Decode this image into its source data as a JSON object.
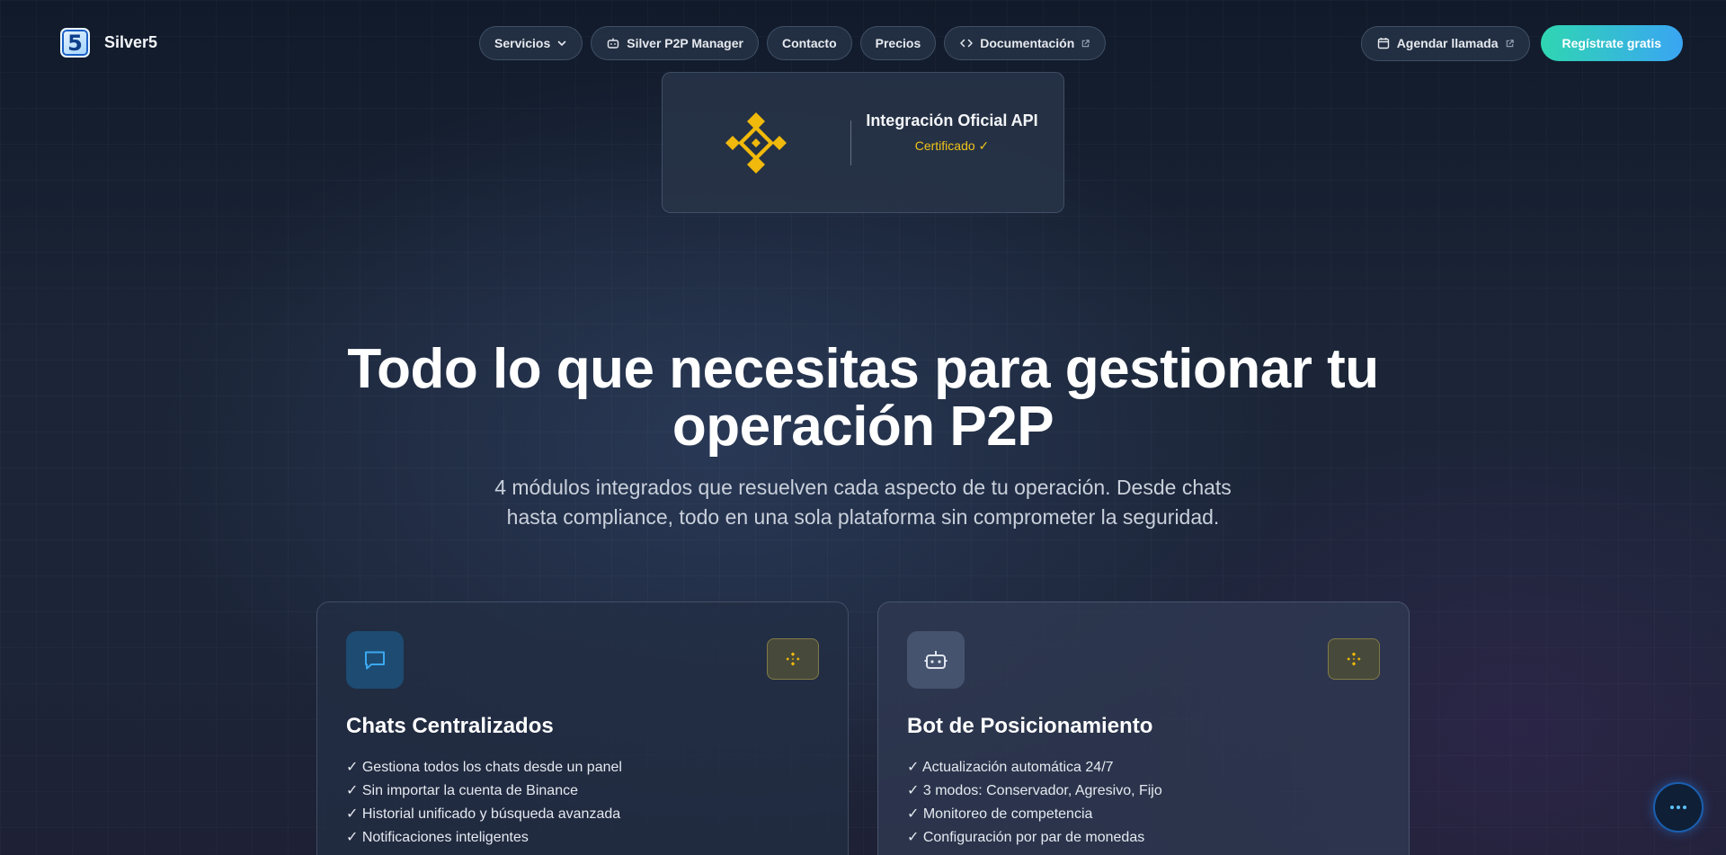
{
  "brand": {
    "name": "Silver5",
    "logo_glyph": "5"
  },
  "nav": {
    "items": [
      {
        "label": "Servicios",
        "icon": "chevron-down-icon"
      },
      {
        "label": "Silver P2P Manager",
        "icon": "bot-icon"
      },
      {
        "label": "Contacto"
      },
      {
        "label": "Precios"
      },
      {
        "label": "Documentación",
        "icon": "code-icon",
        "trailing_icon": "external-link-icon"
      }
    ],
    "call": {
      "label": "Agendar llamada",
      "icon": "calendar-icon",
      "trailing_icon": "external-link-icon"
    },
    "cta": {
      "label": "Regístrate gratis"
    }
  },
  "badge": {
    "title": "Integración Oficial API",
    "status": "Certificado ✓",
    "logo": "binance-logo-icon",
    "accent": "#F0B90B"
  },
  "hero": {
    "title": "Todo lo que necesitas para gestionar tu operación P2P",
    "subtitle": "4 módulos integrados que resuelven cada aspecto de tu operación. Desde chats hasta compliance, todo en una sola plataforma sin comprometer la seguridad."
  },
  "cards": [
    {
      "title": "Chats Centralizados",
      "icon": "chat-bubble-icon",
      "features": [
        "✓ Gestiona todos los chats desde un panel",
        "✓ Sin importar la cuenta de Binance",
        "✓ Historial unificado y búsqueda avanzada",
        "✓ Notificaciones inteligentes"
      ]
    },
    {
      "title": "Bot de Posicionamiento",
      "icon": "bot-icon",
      "features": [
        "✓ Actualización automática 24/7",
        "✓ 3 modos: Conservador, Agresivo, Fijo",
        "✓ Monitoreo de competencia",
        "✓ Configuración por par de monedas"
      ]
    }
  ],
  "chat_widget": {
    "icon": "more-dots-icon"
  },
  "colors": {
    "cta_gradient_start": "#2FD6B2",
    "cta_gradient_end": "#3AA5F3",
    "binance_yellow": "#F0B90B",
    "certified_text": "#F0C419"
  }
}
